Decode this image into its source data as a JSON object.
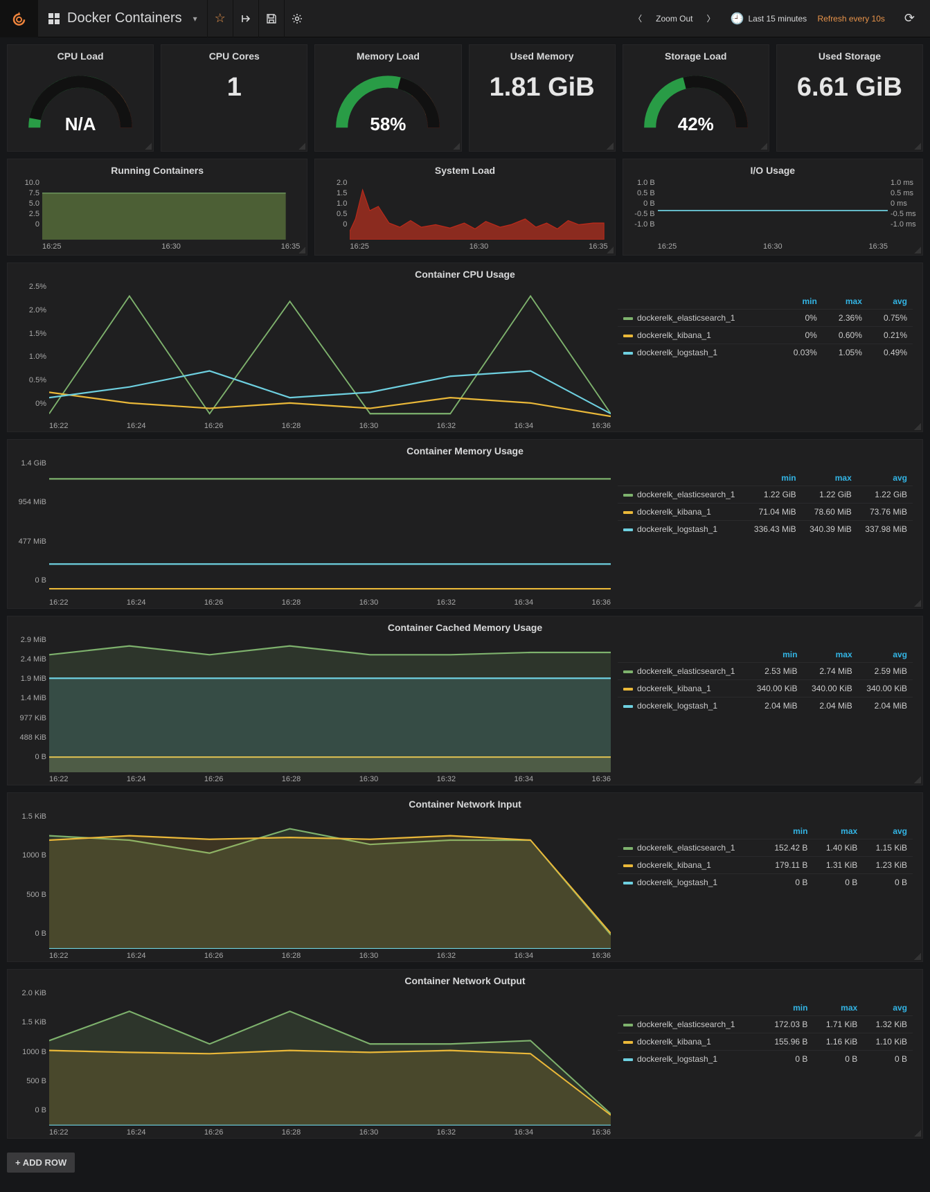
{
  "nav": {
    "dashboard_title": "Docker Containers",
    "zoom_out": "Zoom Out",
    "time_range": "Last 15 minutes",
    "refresh": "Refresh every 10s"
  },
  "colors": {
    "green": "#7eb26d",
    "yellow": "#eab839",
    "cyan": "#6ed0e0",
    "orange": "#ef843c",
    "red": "#bf1b00"
  },
  "stats": {
    "cpu_load": {
      "title": "CPU Load",
      "type": "gauge",
      "value": "N/A",
      "pct": 6
    },
    "cpu_cores": {
      "title": "CPU Cores",
      "type": "number",
      "value": "1"
    },
    "mem_load": {
      "title": "Memory Load",
      "type": "gauge",
      "value": "58%",
      "pct": 58
    },
    "used_mem": {
      "title": "Used Memory",
      "type": "number",
      "value": "1.81 GiB"
    },
    "stor_load": {
      "title": "Storage Load",
      "type": "gauge",
      "value": "42%",
      "pct": 42
    },
    "used_stor": {
      "title": "Used Storage",
      "type": "number",
      "value": "6.61 GiB"
    }
  },
  "mini": {
    "running": {
      "title": "Running Containers",
      "y_ticks": [
        "10.0",
        "7.5",
        "5.0",
        "2.5",
        "0"
      ],
      "x_ticks": [
        "16:25",
        "16:30",
        "16:35"
      ]
    },
    "sysload": {
      "title": "System Load",
      "y_ticks": [
        "2.0",
        "1.5",
        "1.0",
        "0.5",
        "0"
      ],
      "x_ticks": [
        "16:25",
        "16:30",
        "16:35"
      ]
    },
    "io": {
      "title": "I/O Usage",
      "y_left": [
        "1.0 B",
        "0.5 B",
        "0 B",
        "-0.5 B",
        "-1.0 B"
      ],
      "y_right": [
        "1.0 ms",
        "0.5 ms",
        "0 ms",
        "-0.5 ms",
        "-1.0 ms"
      ],
      "x_ticks": [
        "16:25",
        "16:30",
        "16:35"
      ]
    }
  },
  "big_labels": {
    "min": "min",
    "max": "max",
    "avg": "avg"
  },
  "x_ticks_big": [
    "16:22",
    "16:24",
    "16:26",
    "16:28",
    "16:30",
    "16:32",
    "16:34",
    "16:36"
  ],
  "panels": [
    {
      "key": "cpu",
      "title": "Container CPU Usage",
      "y_ticks": [
        "2.5%",
        "2.0%",
        "1.5%",
        "1.0%",
        "0.5%",
        "0%"
      ],
      "legend": [
        {
          "name": "dockerelk_elasticsearch_1",
          "color": "green",
          "min": "0%",
          "max": "2.36%",
          "avg": "0.75%"
        },
        {
          "name": "dockerelk_kibana_1",
          "color": "yellow",
          "min": "0%",
          "max": "0.60%",
          "avg": "0.21%"
        },
        {
          "name": "dockerelk_logstash_1",
          "color": "cyan",
          "min": "0.03%",
          "max": "1.05%",
          "avg": "0.49%"
        }
      ],
      "chart_data": {
        "type": "line",
        "xlabel": "",
        "ylabel": "%",
        "ylim": [
          0,
          2.5
        ],
        "x": [
          "16:22",
          "16:24",
          "16:26",
          "16:28",
          "16:30",
          "16:32",
          "16:34",
          "16:36"
        ],
        "series": [
          {
            "name": "dockerelk_elasticsearch_1",
            "values": [
              0.1,
              2.3,
              0.1,
              2.2,
              0.1,
              0.1,
              2.3,
              0.1
            ]
          },
          {
            "name": "dockerelk_kibana_1",
            "values": [
              0.5,
              0.3,
              0.2,
              0.3,
              0.2,
              0.4,
              0.3,
              0.05
            ]
          },
          {
            "name": "dockerelk_logstash_1",
            "values": [
              0.4,
              0.6,
              0.9,
              0.4,
              0.5,
              0.8,
              0.9,
              0.1
            ]
          }
        ]
      }
    },
    {
      "key": "mem",
      "title": "Container Memory Usage",
      "y_ticks": [
        "1.4 GiB",
        "954 MiB",
        "477 MiB",
        "0 B"
      ],
      "legend": [
        {
          "name": "dockerelk_elasticsearch_1",
          "color": "green",
          "min": "1.22 GiB",
          "max": "1.22 GiB",
          "avg": "1.22 GiB"
        },
        {
          "name": "dockerelk_kibana_1",
          "color": "yellow",
          "min": "71.04 MiB",
          "max": "78.60 MiB",
          "avg": "73.76 MiB"
        },
        {
          "name": "dockerelk_logstash_1",
          "color": "cyan",
          "min": "336.43 MiB",
          "max": "340.39 MiB",
          "avg": "337.98 MiB"
        }
      ],
      "chart_data": {
        "type": "line",
        "ylim": [
          0,
          1430
        ],
        "x": [
          "16:22",
          "16:24",
          "16:26",
          "16:28",
          "16:30",
          "16:32",
          "16:34",
          "16:36"
        ],
        "series": [
          {
            "name": "dockerelk_elasticsearch_1",
            "values": [
              1249,
              1249,
              1249,
              1249,
              1249,
              1249,
              1249,
              1249
            ]
          },
          {
            "name": "dockerelk_kibana_1",
            "values": [
              74,
              74,
              74,
              74,
              74,
              74,
              74,
              74
            ]
          },
          {
            "name": "dockerelk_logstash_1",
            "values": [
              338,
              338,
              338,
              338,
              338,
              338,
              338,
              338
            ]
          }
        ]
      }
    },
    {
      "key": "cached",
      "title": "Container Cached Memory Usage",
      "y_ticks": [
        "2.9 MiB",
        "2.4 MiB",
        "1.9 MiB",
        "1.4 MiB",
        "977 KiB",
        "488 KiB",
        "0 B"
      ],
      "legend": [
        {
          "name": "dockerelk_elasticsearch_1",
          "color": "green",
          "min": "2.53 MiB",
          "max": "2.74 MiB",
          "avg": "2.59 MiB"
        },
        {
          "name": "dockerelk_kibana_1",
          "color": "yellow",
          "min": "340.00 KiB",
          "max": "340.00 KiB",
          "avg": "340.00 KiB"
        },
        {
          "name": "dockerelk_logstash_1",
          "color": "cyan",
          "min": "2.04 MiB",
          "max": "2.04 MiB",
          "avg": "2.04 MiB"
        }
      ],
      "chart_data": {
        "type": "line",
        "ylim": [
          0,
          2.9
        ],
        "x": [
          "16:22",
          "16:24",
          "16:26",
          "16:28",
          "16:30",
          "16:32",
          "16:34",
          "16:36"
        ],
        "series": [
          {
            "name": "dockerelk_elasticsearch_1",
            "values": [
              2.55,
              2.74,
              2.55,
              2.74,
              2.55,
              2.55,
              2.6,
              2.6
            ]
          },
          {
            "name": "dockerelk_kibana_1",
            "values": [
              0.33,
              0.33,
              0.33,
              0.33,
              0.33,
              0.33,
              0.33,
              0.33
            ]
          },
          {
            "name": "dockerelk_logstash_1",
            "values": [
              2.04,
              2.04,
              2.04,
              2.04,
              2.04,
              2.04,
              2.04,
              2.04
            ]
          }
        ]
      }
    },
    {
      "key": "netin",
      "title": "Container Network Input",
      "y_ticks": [
        "1.5 KiB",
        "1000 B",
        "500 B",
        "0 B"
      ],
      "legend": [
        {
          "name": "dockerelk_elasticsearch_1",
          "color": "green",
          "min": "152.42 B",
          "max": "1.40 KiB",
          "avg": "1.15 KiB"
        },
        {
          "name": "dockerelk_kibana_1",
          "color": "yellow",
          "min": "179.11 B",
          "max": "1.31 KiB",
          "avg": "1.23 KiB"
        },
        {
          "name": "dockerelk_logstash_1",
          "color": "cyan",
          "min": "0 B",
          "max": "0 B",
          "avg": "0 B"
        }
      ],
      "chart_data": {
        "type": "line",
        "ylim": [
          0,
          1536
        ],
        "x": [
          "16:22",
          "16:24",
          "16:26",
          "16:28",
          "16:30",
          "16:32",
          "16:34",
          "16:36"
        ],
        "series": [
          {
            "name": "dockerelk_elasticsearch_1",
            "values": [
              1300,
              1250,
              1100,
              1380,
              1200,
              1250,
              1250,
              160
            ]
          },
          {
            "name": "dockerelk_kibana_1",
            "values": [
              1250,
              1300,
              1260,
              1280,
              1260,
              1300,
              1250,
              180
            ]
          },
          {
            "name": "dockerelk_logstash_1",
            "values": [
              0,
              0,
              0,
              0,
              0,
              0,
              0,
              0
            ]
          }
        ]
      }
    },
    {
      "key": "netout",
      "title": "Container Network Output",
      "y_ticks": [
        "2.0 KiB",
        "1.5 KiB",
        "1000 B",
        "500 B",
        "0 B"
      ],
      "legend": [
        {
          "name": "dockerelk_elasticsearch_1",
          "color": "green",
          "min": "172.03 B",
          "max": "1.71 KiB",
          "avg": "1.32 KiB"
        },
        {
          "name": "dockerelk_kibana_1",
          "color": "yellow",
          "min": "155.96 B",
          "max": "1.16 KiB",
          "avg": "1.10 KiB"
        },
        {
          "name": "dockerelk_logstash_1",
          "color": "cyan",
          "min": "0 B",
          "max": "0 B",
          "avg": "0 B"
        }
      ],
      "chart_data": {
        "type": "line",
        "ylim": [
          0,
          2048
        ],
        "x": [
          "16:22",
          "16:24",
          "16:26",
          "16:28",
          "16:30",
          "16:32",
          "16:34",
          "16:36"
        ],
        "series": [
          {
            "name": "dockerelk_elasticsearch_1",
            "values": [
              1300,
              1750,
              1250,
              1750,
              1250,
              1250,
              1300,
              180
            ]
          },
          {
            "name": "dockerelk_kibana_1",
            "values": [
              1150,
              1120,
              1100,
              1150,
              1120,
              1150,
              1100,
              160
            ]
          },
          {
            "name": "dockerelk_logstash_1",
            "values": [
              0,
              0,
              0,
              0,
              0,
              0,
              0,
              0
            ]
          }
        ]
      }
    }
  ],
  "add_row": "ADD ROW"
}
